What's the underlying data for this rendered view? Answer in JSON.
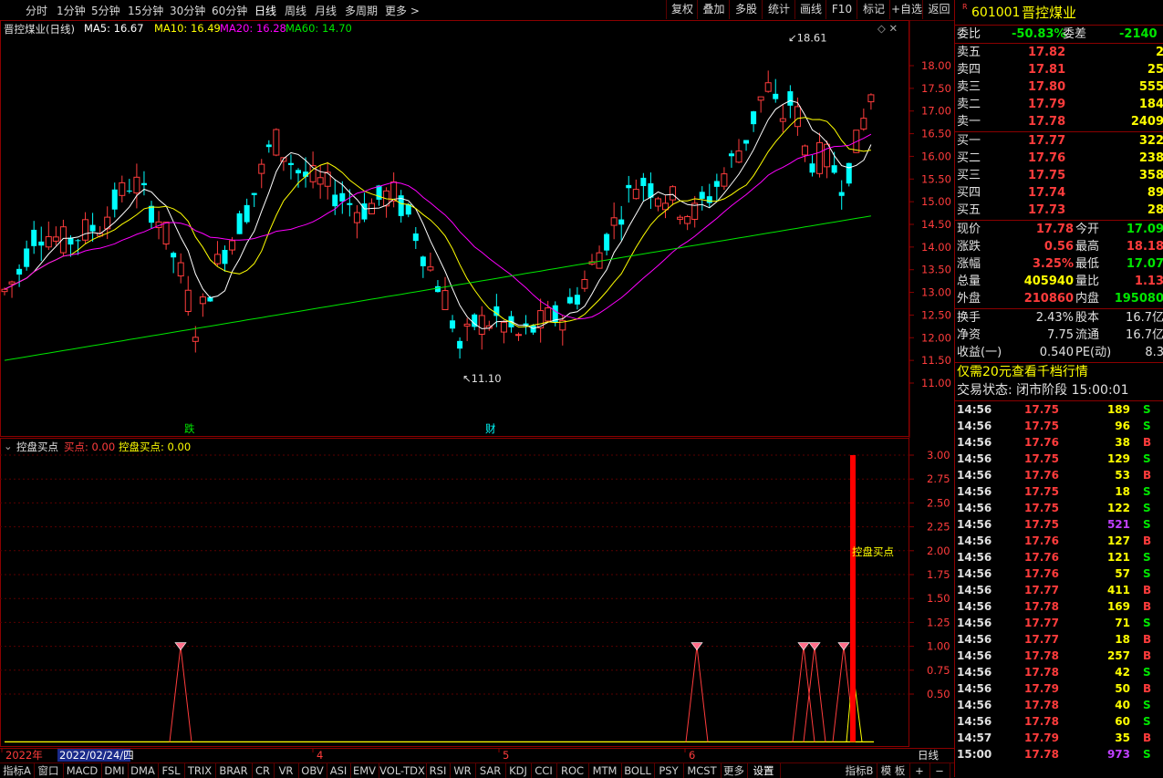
{
  "toolbar": {
    "periods": [
      "分时",
      "1分钟",
      "5分钟",
      "15分钟",
      "30分钟",
      "60分钟",
      "日线",
      "周线",
      "月线",
      "多周期",
      "更多 >"
    ],
    "right_buttons": [
      "复权",
      "叠加",
      "多股",
      "统计",
      "画线",
      "F10",
      "标记",
      "+自选",
      "返回"
    ]
  },
  "main_chart": {
    "title": "晋控煤业(日线)",
    "ma_labels": [
      {
        "text": "MA5: 16.67",
        "color": "#ffffff"
      },
      {
        "text": "MA10: 16.49",
        "color": "#ffff00"
      },
      {
        "text": "MA20: 16.28",
        "color": "#ff00ff"
      },
      {
        "text": "MA60: 14.70",
        "color": "#00e600"
      }
    ],
    "high_label": "18.61",
    "low_label": "11.10",
    "event_labels": [
      "跌",
      "财"
    ],
    "y_ticks": [
      "18.00",
      "17.50",
      "17.00",
      "16.50",
      "16.00",
      "15.50",
      "15.00",
      "14.50",
      "14.00",
      "13.50",
      "13.00",
      "12.50",
      "12.00",
      "11.50",
      "11.00"
    ]
  },
  "indicator": {
    "title": "控盘买点",
    "values": [
      {
        "text": "买点: 0.00",
        "color": "#ff3c3c"
      },
      {
        "text": "控盘买点: 0.00",
        "color": "#ffff00"
      }
    ],
    "annotation": "控盘买点",
    "y_ticks": [
      "3.00",
      "2.75",
      "2.50",
      "2.25",
      "2.00",
      "1.75",
      "1.50",
      "1.25",
      "1.00",
      "0.75",
      "0.50"
    ]
  },
  "x_axis": {
    "labels": [
      "2022年",
      "4",
      "5",
      "6"
    ],
    "cursor_date": "2022/02/24/四"
  },
  "bottom_tabs": [
    "指标A",
    "窗口",
    "MACD",
    "DMI",
    "DMA",
    "FSL",
    "TRIX",
    "BRAR",
    "CR",
    "VR",
    "OBV",
    "ASI",
    "EMV",
    "VOL-TDX",
    "RSI",
    "WR",
    "SAR",
    "KDJ",
    "CCI",
    "ROC",
    "MTM",
    "BOLL",
    "PSY",
    "MCST",
    "更多",
    "设置"
  ],
  "bottom_right": {
    "indicator_b": "指标B",
    "template": "模 板",
    "plus": "+",
    "minus": "−",
    "period": "日线"
  },
  "quote": {
    "code": "601001",
    "name": "晋控煤业",
    "weibi_label": "委比",
    "weibi_value": "-50.83%",
    "weicha_label": "委差",
    "weicha_value": "-2140",
    "asks": [
      {
        "label": "卖五",
        "price": "17.82",
        "vol": "2"
      },
      {
        "label": "卖四",
        "price": "17.81",
        "vol": "25"
      },
      {
        "label": "卖三",
        "price": "17.80",
        "vol": "555"
      },
      {
        "label": "卖二",
        "price": "17.79",
        "vol": "184"
      },
      {
        "label": "卖一",
        "price": "17.78",
        "vol": "2409"
      }
    ],
    "bids": [
      {
        "label": "买一",
        "price": "17.77",
        "vol": "322"
      },
      {
        "label": "买二",
        "price": "17.76",
        "vol": "238"
      },
      {
        "label": "买三",
        "price": "17.75",
        "vol": "358"
      },
      {
        "label": "买四",
        "price": "17.74",
        "vol": "89"
      },
      {
        "label": "买五",
        "price": "17.73",
        "vol": "28"
      }
    ],
    "stats": [
      {
        "l1": "现价",
        "v1": "17.78",
        "c1": "#ff3c3c",
        "l2": "今开",
        "v2": "17.09",
        "c2": "#00e600"
      },
      {
        "l1": "涨跌",
        "v1": "0.56",
        "c1": "#ff3c3c",
        "l2": "最高",
        "v2": "18.18",
        "c2": "#ff3c3c"
      },
      {
        "l1": "涨幅",
        "v1": "3.25%",
        "c1": "#ff3c3c",
        "l2": "最低",
        "v2": "17.07",
        "c2": "#00e600"
      },
      {
        "l1": "总量",
        "v1": "405940",
        "c1": "#ffff00",
        "l2": "量比",
        "v2": "1.13",
        "c2": "#ff3c3c"
      },
      {
        "l1": "外盘",
        "v1": "210860",
        "c1": "#ff3c3c",
        "l2": "内盘",
        "v2": "195080",
        "c2": "#00e600"
      }
    ],
    "stats2": [
      {
        "l1": "换手",
        "v1": "2.43%",
        "l2": "股本",
        "v2": "16.7亿"
      },
      {
        "l1": "净资",
        "v1": "7.75",
        "l2": "流通",
        "v2": "16.7亿"
      },
      {
        "l1": "收益(一)",
        "v1": "0.540",
        "l2": "PE(动)",
        "v2": "8.3"
      }
    ],
    "promo": "仅需20元查看千档行情",
    "trade_status": "交易状态: 闭市阶段 15:00:01"
  },
  "ticks": [
    {
      "t": "14:56",
      "p": "17.75",
      "v": "189",
      "s": "S"
    },
    {
      "t": "14:56",
      "p": "17.75",
      "v": "96",
      "s": "S"
    },
    {
      "t": "14:56",
      "p": "17.76",
      "v": "38",
      "s": "B"
    },
    {
      "t": "14:56",
      "p": "17.75",
      "v": "129",
      "s": "S"
    },
    {
      "t": "14:56",
      "p": "17.76",
      "v": "53",
      "s": "B"
    },
    {
      "t": "14:56",
      "p": "17.75",
      "v": "18",
      "s": "S"
    },
    {
      "t": "14:56",
      "p": "17.75",
      "v": "122",
      "s": "S"
    },
    {
      "t": "14:56",
      "p": "17.75",
      "v": "521",
      "s": "S"
    },
    {
      "t": "14:56",
      "p": "17.76",
      "v": "127",
      "s": "B"
    },
    {
      "t": "14:56",
      "p": "17.76",
      "v": "121",
      "s": "S"
    },
    {
      "t": "14:56",
      "p": "17.76",
      "v": "57",
      "s": "S"
    },
    {
      "t": "14:56",
      "p": "17.77",
      "v": "411",
      "s": "B"
    },
    {
      "t": "14:56",
      "p": "17.78",
      "v": "169",
      "s": "B"
    },
    {
      "t": "14:56",
      "p": "17.77",
      "v": "71",
      "s": "S"
    },
    {
      "t": "14:56",
      "p": "17.77",
      "v": "18",
      "s": "B"
    },
    {
      "t": "14:56",
      "p": "17.78",
      "v": "257",
      "s": "B"
    },
    {
      "t": "14:56",
      "p": "17.78",
      "v": "42",
      "s": "S"
    },
    {
      "t": "14:56",
      "p": "17.79",
      "v": "50",
      "s": "B"
    },
    {
      "t": "14:56",
      "p": "17.78",
      "v": "40",
      "s": "S"
    },
    {
      "t": "14:56",
      "p": "17.78",
      "v": "60",
      "s": "S"
    },
    {
      "t": "14:57",
      "p": "17.79",
      "v": "35",
      "s": "B"
    },
    {
      "t": "15:00",
      "p": "17.78",
      "v": "973",
      "s": "S"
    }
  ],
  "colors": {
    "up": "#ff3c3c",
    "down": "#00ffff",
    "grid": "#8b0000",
    "ma5": "#ffffff",
    "ma10": "#ffff00",
    "ma20": "#ff00ff",
    "ma60": "#00e600"
  }
}
